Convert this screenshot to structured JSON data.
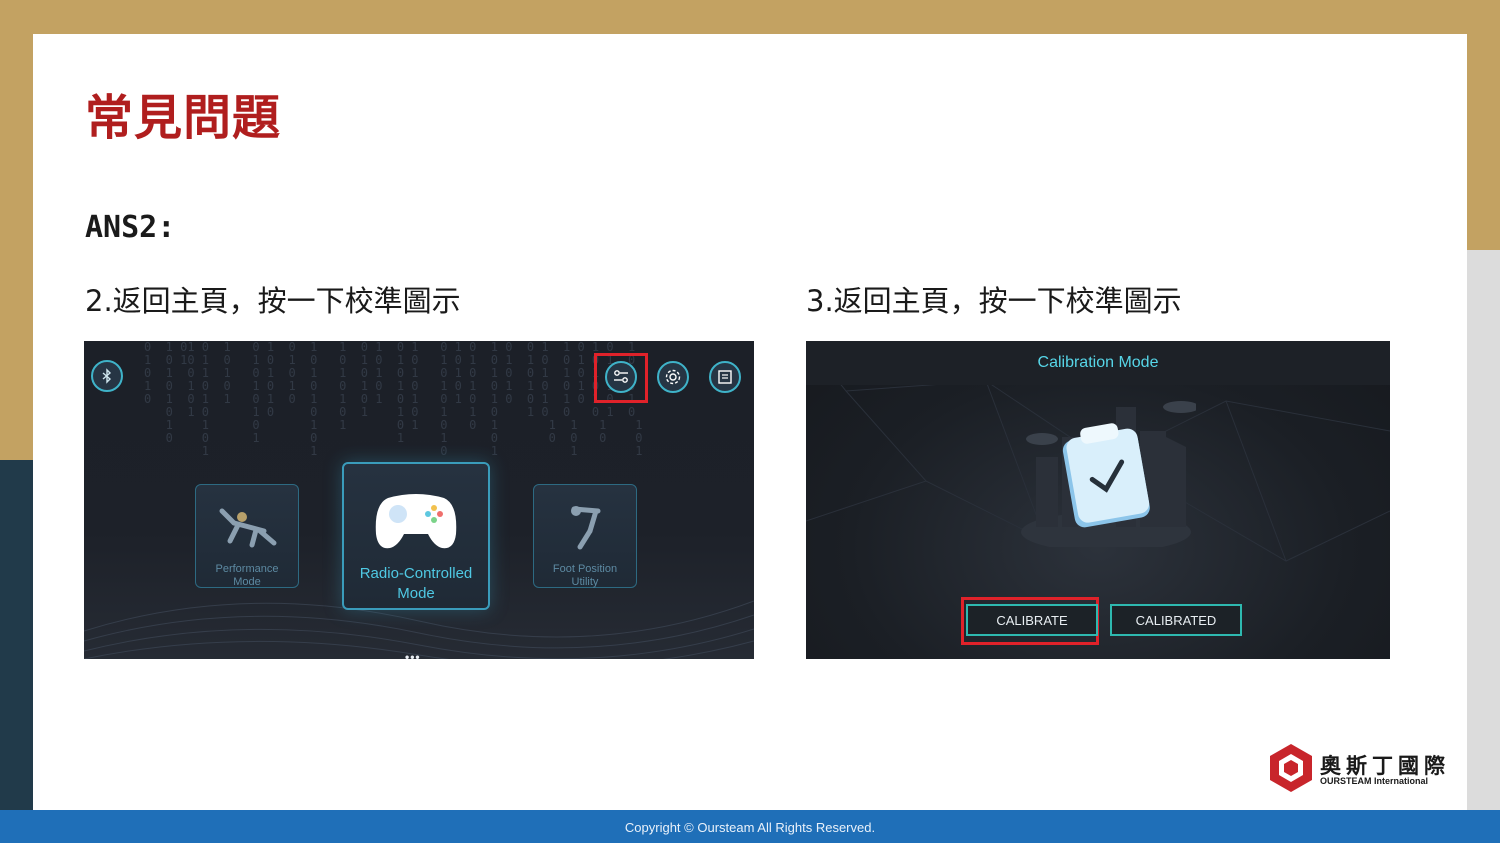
{
  "slide": {
    "title": "常見問題",
    "answer_label": "ANS2:",
    "step_left": "2.返回主頁，按一下校準圖示",
    "step_right": "3.返回主頁，按一下校準圖示",
    "footer": "Copyright © Oursteam All Rights Reserved."
  },
  "screenshot_home": {
    "modes": [
      {
        "label_line1": "Performance",
        "label_line2": "Mode"
      },
      {
        "label_line1": "Radio-Controlled",
        "label_line2": "Mode"
      },
      {
        "label_line1": "Foot Position",
        "label_line2": "Utility"
      }
    ],
    "pager": "•••",
    "matrix_text": "0  1 01 0  1   0 1  0  1   1  0 1  0 1   0 1 0  1 0  0 1  1 0 1 0  1\n1  0 10 1  0   1 0  1  0   0  1 0  1 0   1 0 1  0 1  1 0  0 1 0 1  0\n0  1  0 1  1   0 1  0  1   1  0 1  0 1   0 1 0  1 0  0 1  1 0 1 0  1\n1  0  1 0  0   1 0  1  0   0  1 0  1 0   1 0 1  0 1  1 0  0 1 0 1  0\n0  1  0 1  1   0 1  0  1   1  0 1  0 1   0 1 0  1 0  0 1  1 0 1 0  1\n   0  1 0      1 0     0   0  1    1 0   1   1  0    1 0  0   0 1  0\n   1    1      0       1   1       0 1   0   0  1       1  1   1    1\n   0    0      1       0           1     1      0       0  0   0    0\n        1              1                 0      1          1        1"
  },
  "screenshot_calibration": {
    "header": "Calibration Mode",
    "calibrate_label": "CALIBRATE",
    "calibrated_label": "CALIBRATED"
  },
  "logo": {
    "name_cn": "奧斯丁國際",
    "name_en": "OURSTEAM International"
  },
  "colors": {
    "title_red": "#b01e1e",
    "highlight_red": "#e0222a",
    "footer_blue": "#1f6fb8",
    "frame_gold": "#c3a262",
    "accent_cyan": "#3fb3c9"
  }
}
